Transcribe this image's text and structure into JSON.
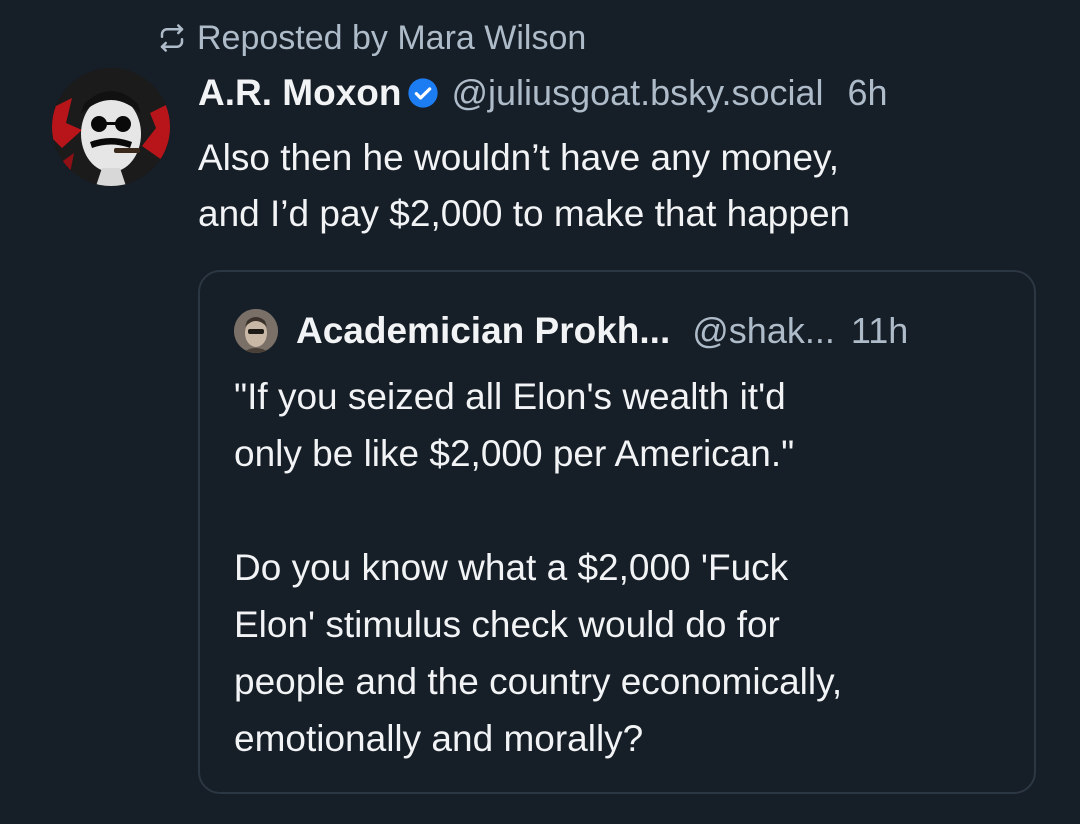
{
  "repost": {
    "icon": "repost-icon",
    "text": "Reposted by Mara Wilson"
  },
  "post": {
    "author_name": "A.R. Moxon",
    "verified_icon": "verified-check-icon",
    "handle": "@juliusgoat.bsky.social",
    "time": "6h",
    "text": "Also then he wouldn’t have any money,\nand I’d pay $2,000 to make that happen"
  },
  "quote": {
    "author_name": "Academician Prokh...",
    "handle": "@shak...",
    "time": "11h",
    "text": "\"If you seized all Elon's wealth it'd\nonly be like $2,000 per American.\"\n\nDo you know what a $2,000 'Fuck\nElon' stimulus check would do for\npeople and the country economically,\nemotionally and morally?"
  },
  "colors": {
    "background": "#161e27",
    "primary_text": "#f1f3f5",
    "secondary_text": "#aebbc9",
    "border": "#2c3744",
    "verified_badge": "#1c7cf2"
  }
}
